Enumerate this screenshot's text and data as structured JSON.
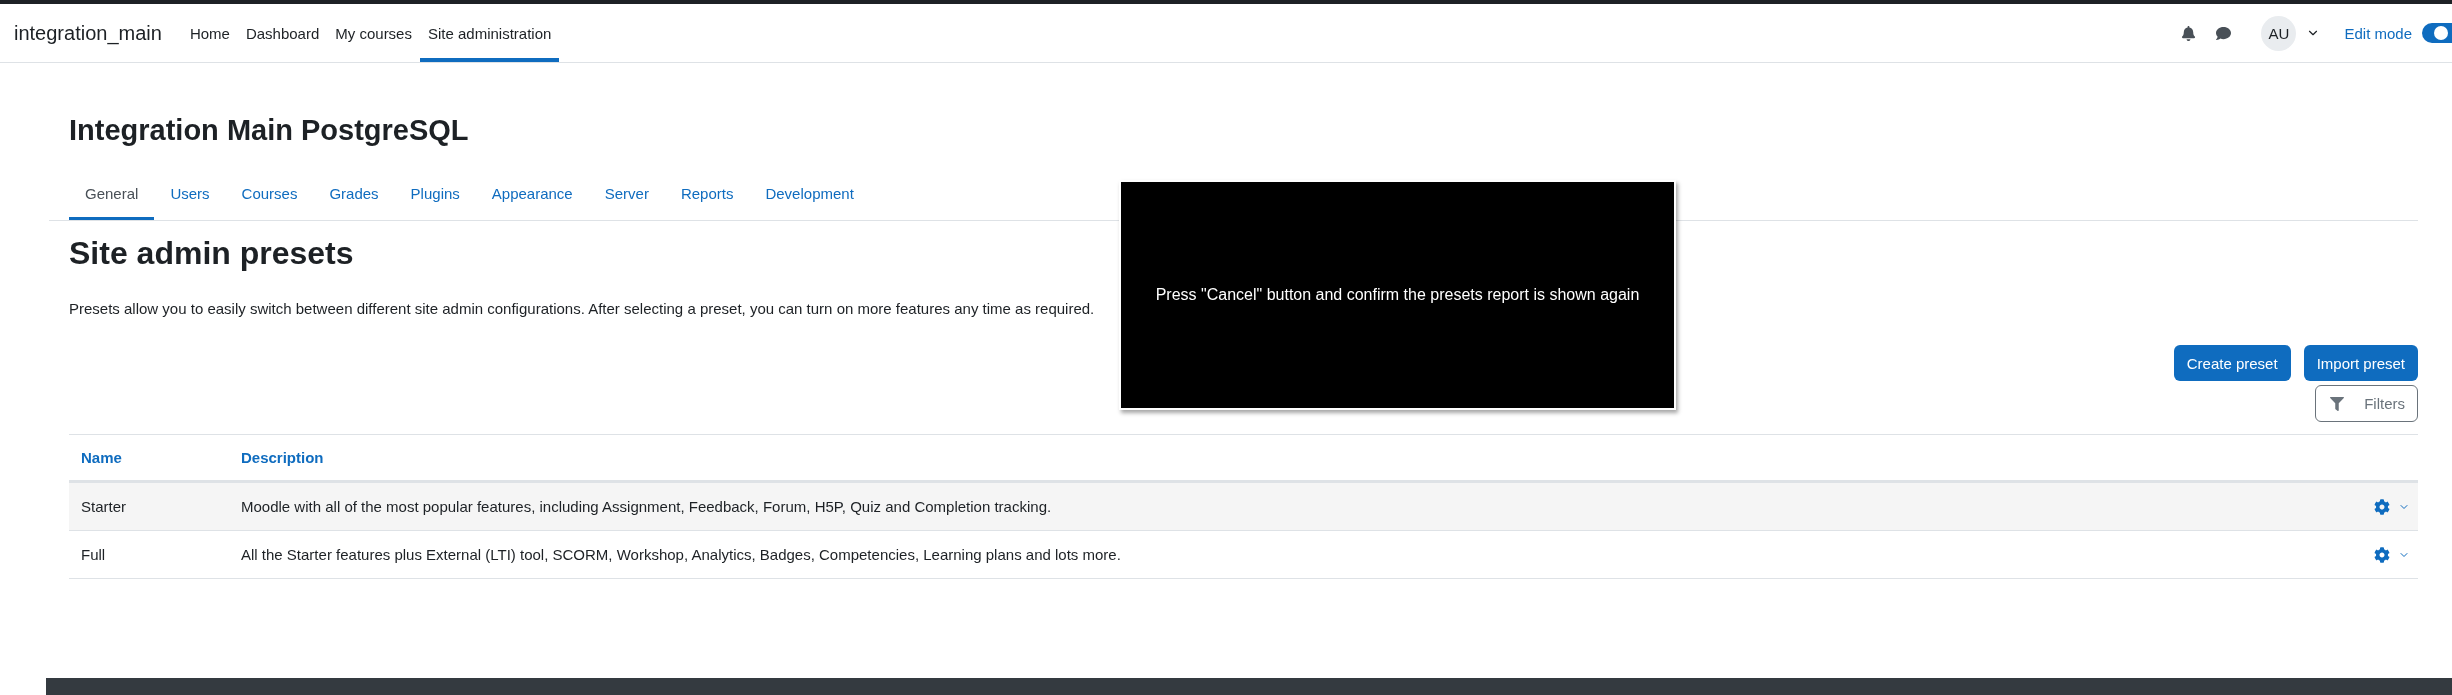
{
  "navbar": {
    "brand": "integration_main",
    "items": [
      {
        "label": "Home",
        "selected": false
      },
      {
        "label": "Dashboard",
        "selected": false
      },
      {
        "label": "My courses",
        "selected": false
      },
      {
        "label": "Site administration",
        "selected": true
      }
    ],
    "user_initials": "AU",
    "edit_mode": {
      "label": "Edit mode",
      "on": true
    }
  },
  "page_title": "Integration Main PostgreSQL",
  "tabs": [
    {
      "label": "General",
      "selected": true
    },
    {
      "label": "Users",
      "selected": false
    },
    {
      "label": "Courses",
      "selected": false
    },
    {
      "label": "Grades",
      "selected": false
    },
    {
      "label": "Plugins",
      "selected": false
    },
    {
      "label": "Appearance",
      "selected": false
    },
    {
      "label": "Server",
      "selected": false
    },
    {
      "label": "Reports",
      "selected": false
    },
    {
      "label": "Development",
      "selected": false
    }
  ],
  "heading": "Site admin presets",
  "intro": "Presets allow you to easily switch between different site admin configurations. After selecting a preset, you can turn on more features any time as required.",
  "buttons": [
    "Create preset",
    "Import preset"
  ],
  "filters_label": "Filters",
  "table": {
    "columns": [
      "Name",
      "Description"
    ],
    "rows": [
      {
        "name": "Starter",
        "description": "Moodle with all of the most popular features, including Assignment, Feedback, Forum, H5P, Quiz and Completion tracking."
      },
      {
        "name": "Full",
        "description": "All the Starter features plus External (LTI) tool, SCORM, Workshop, Analytics, Badges, Competencies, Learning plans and lots more."
      }
    ]
  },
  "overlay_message": "Press \"Cancel\" button and confirm the presets report is shown again"
}
